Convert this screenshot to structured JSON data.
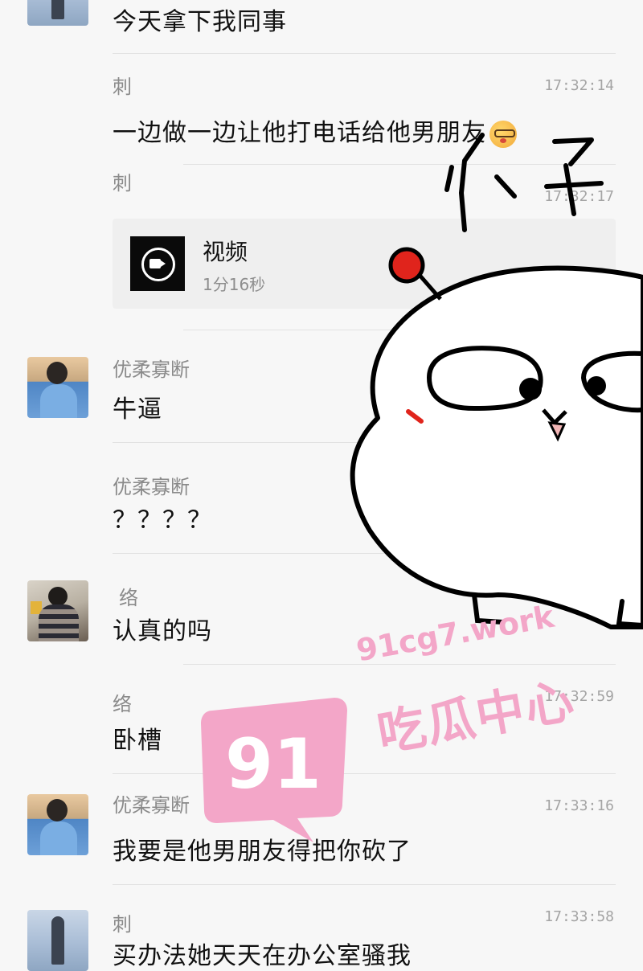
{
  "messages": [
    {
      "sender": "",
      "text": "今天拿下我同事",
      "time": ""
    },
    {
      "sender": "刺",
      "text": "一边做一边让他打电话给他男朋友",
      "time": "17:32:14",
      "emoji": "face-with-glasses-emoji"
    },
    {
      "sender": "刺",
      "text": "",
      "time": "17:32:17"
    },
    {
      "sender": "优柔寡断",
      "text": "牛逼",
      "time": ""
    },
    {
      "sender": "优柔寡断",
      "text": "？？？？",
      "time": ""
    },
    {
      "sender": "络",
      "text": "认真的吗",
      "time": ""
    },
    {
      "sender": "络",
      "text": "卧槽",
      "time": "17:32:59"
    },
    {
      "sender": "优柔寡断",
      "text": "我要是他男朋友得把你砍了",
      "time": "17:33:16"
    },
    {
      "sender": "刺",
      "text": "买办法她天天在办公室骚我",
      "time": "17:33:58"
    }
  ],
  "video": {
    "title": "视频",
    "duration": "1分16秒"
  },
  "sticker": {
    "text": "小子"
  },
  "watermark": {
    "site": "91cg7.work",
    "badge": "91",
    "name": "吃瓜中心"
  },
  "colors": {
    "watermark_pink": "#f3a6c8",
    "sticker_red": "#e0241c"
  }
}
